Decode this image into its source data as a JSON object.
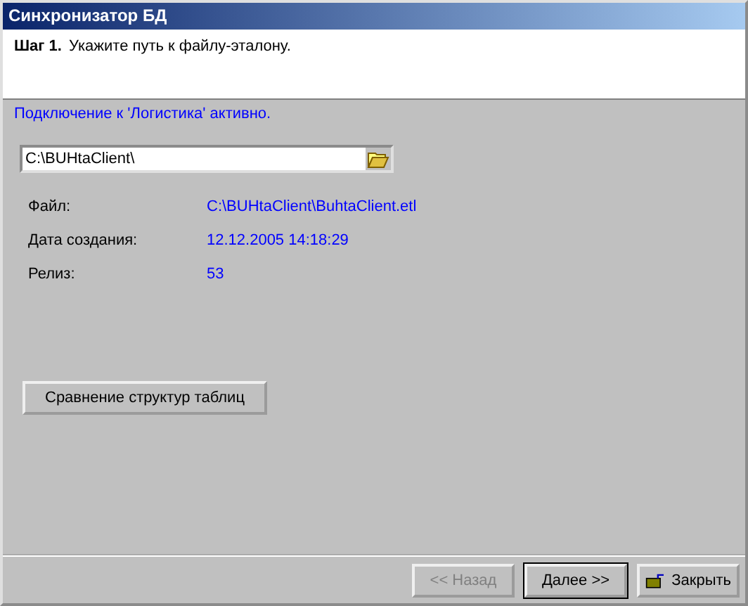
{
  "window": {
    "title": "Синхронизатор БД"
  },
  "header": {
    "step": "Шаг 1.",
    "instruction": "Укажите путь к файлу-эталону."
  },
  "status": "Подключение к 'Логистика' активно.",
  "path_field": {
    "value": "C:\\BUHtaClient\\"
  },
  "info": [
    {
      "label": "Файл:",
      "value": "C:\\BUHtaClient\\BuhtaClient.etl"
    },
    {
      "label": "Дата создания:",
      "value": "12.12.2005 14:18:29"
    },
    {
      "label": "Релиз:",
      "value": "53"
    }
  ],
  "compare_button": "Сравнение структур таблиц",
  "buttons": [
    {
      "kind": "nav",
      "label": "<< Назад",
      "disabled": true,
      "default": false
    },
    {
      "kind": "nav",
      "label": "Далее >>",
      "disabled": false,
      "default": true
    },
    {
      "kind": "close",
      "label": "Закрыть",
      "disabled": false,
      "default": false
    }
  ]
}
